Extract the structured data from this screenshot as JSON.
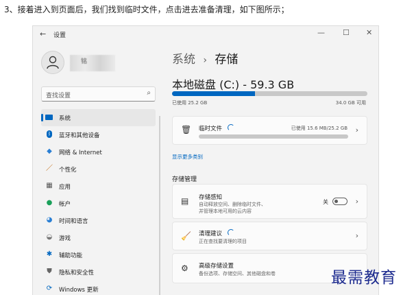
{
  "caption": "3、接着进入到页面后，我们找到临时文件，点击进去准备清理，如下图所示；",
  "window": {
    "title": "设置",
    "back_glyph": "←",
    "minimize": "—",
    "maximize": "☐",
    "close": "✕"
  },
  "profile": {
    "name": "铭"
  },
  "search": {
    "placeholder": "查找设置"
  },
  "sidebar": {
    "items": [
      {
        "label": "系统",
        "icon": "monitor-icon",
        "color": "#0067c0"
      },
      {
        "label": "蓝牙和其他设备",
        "icon": "bluetooth-icon",
        "color": "#0067c0"
      },
      {
        "label": "网络 & Internet",
        "icon": "wifi-icon",
        "color": "#2a7fd4"
      },
      {
        "label": "个性化",
        "icon": "brush-icon",
        "color": "#c06000"
      },
      {
        "label": "应用",
        "icon": "apps-icon",
        "color": "#555555"
      },
      {
        "label": "帐户",
        "icon": "person-icon",
        "color": "#1aa05a"
      },
      {
        "label": "时间和语言",
        "icon": "globe-icon",
        "color": "#2a7fd4"
      },
      {
        "label": "游戏",
        "icon": "gamepad-icon",
        "color": "#777777"
      },
      {
        "label": "辅助功能",
        "icon": "accessibility-icon",
        "color": "#0067c0"
      },
      {
        "label": "隐私和安全性",
        "icon": "shield-icon",
        "color": "#666666"
      },
      {
        "label": "Windows 更新",
        "icon": "update-icon",
        "color": "#0067c0"
      }
    ]
  },
  "main": {
    "breadcrumb_parent": "系统",
    "breadcrumb_sep": "›",
    "breadcrumb_current": "存储",
    "drive_title": "本地磁盘 (C:) - 59.3 GB",
    "used_label": "已使用 25.2 GB",
    "available_label": "34.0 GB 可用",
    "used_fraction": 0.425,
    "temp": {
      "title": "临时文件",
      "status": "已使用 15.6 MB/25.2 GB"
    },
    "show_more": "显示更多类别",
    "section_title": "存储管理",
    "storage_sense": {
      "title": "存储感知",
      "desc1": "自动释放空间、删除临时文件、",
      "desc2": "并管理本地可用的云内容",
      "toggle_label": "关",
      "toggle_on": false
    },
    "cleanup": {
      "title": "清理建议",
      "desc": "正在查找要清理的项目"
    },
    "advanced": {
      "title": "高级存储设置",
      "desc": "备份选项、存储空间、其他磁盘和卷"
    },
    "accent_color": "#0067c0"
  },
  "watermark": "最需教育"
}
